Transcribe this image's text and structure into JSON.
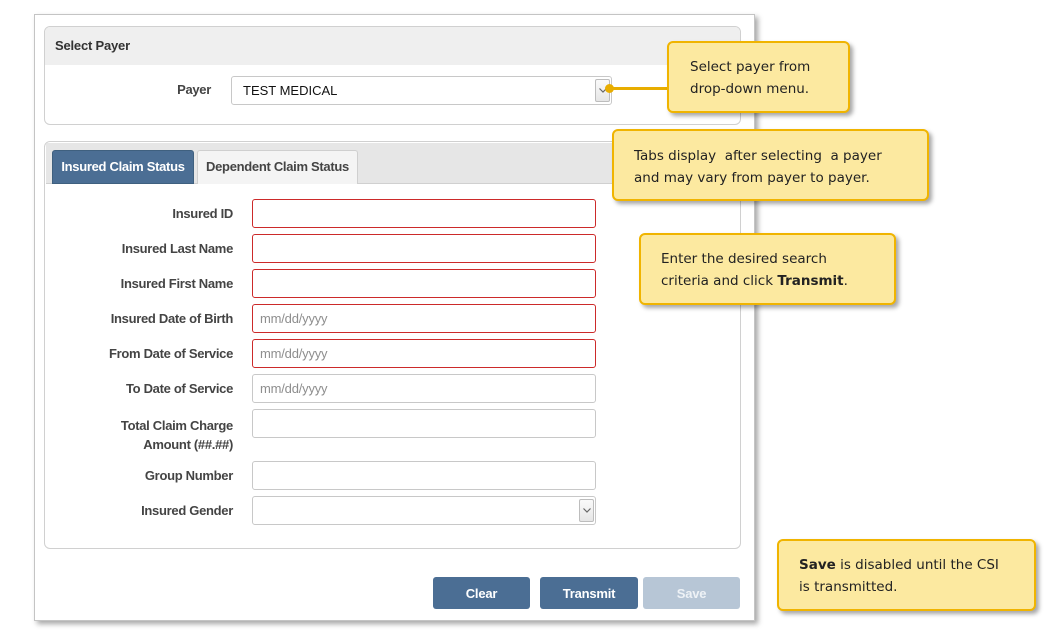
{
  "select_payer": {
    "header": "Select Payer",
    "payer_label": "Payer",
    "payer_value": "TEST MEDICAL"
  },
  "tabs": [
    {
      "label": "Insured Claim Status",
      "active": true
    },
    {
      "label": "Dependent Claim Status",
      "active": false
    }
  ],
  "form": {
    "insured_id": {
      "label": "Insured ID",
      "value": "",
      "required": true
    },
    "last_name": {
      "label": "Insured Last Name",
      "value": "",
      "required": true
    },
    "first_name": {
      "label": "Insured First Name",
      "value": "",
      "required": true
    },
    "dob": {
      "label": "Insured Date of Birth",
      "placeholder": "mm/dd/yyyy",
      "required": true
    },
    "from_dos": {
      "label": "From Date of Service",
      "placeholder": "mm/dd/yyyy",
      "required": true
    },
    "to_dos": {
      "label": "To Date of Service",
      "placeholder": "mm/dd/yyyy",
      "required": false
    },
    "total_charge": {
      "label_line1": "Total Claim Charge",
      "label_line2": "Amount (##.##)",
      "value": ""
    },
    "group_number": {
      "label": "Group Number",
      "value": ""
    },
    "gender": {
      "label": "Insured Gender",
      "value": ""
    }
  },
  "buttons": {
    "clear": "Clear",
    "transmit": "Transmit",
    "save": "Save",
    "save_disabled": true
  },
  "callouts": {
    "payer": {
      "line1": "Select payer from",
      "line2": "drop-down menu."
    },
    "tabs": {
      "line1": "Tabs display  after selecting  a payer",
      "line2": "and may vary from payer to payer."
    },
    "search": {
      "line1": "Enter the desired search",
      "line2_pre": "criteria and click ",
      "line2_bold": "Transmit",
      "line2_post": "."
    },
    "save": {
      "bold": "Save",
      "line1_post": " is disabled until the CSI",
      "line2": "is transmitted."
    }
  },
  "colors": {
    "accent": "#4b6e94",
    "required_border": "#cc2a2a",
    "callout_fill": "#fce9a0",
    "callout_border": "#f0b400"
  }
}
